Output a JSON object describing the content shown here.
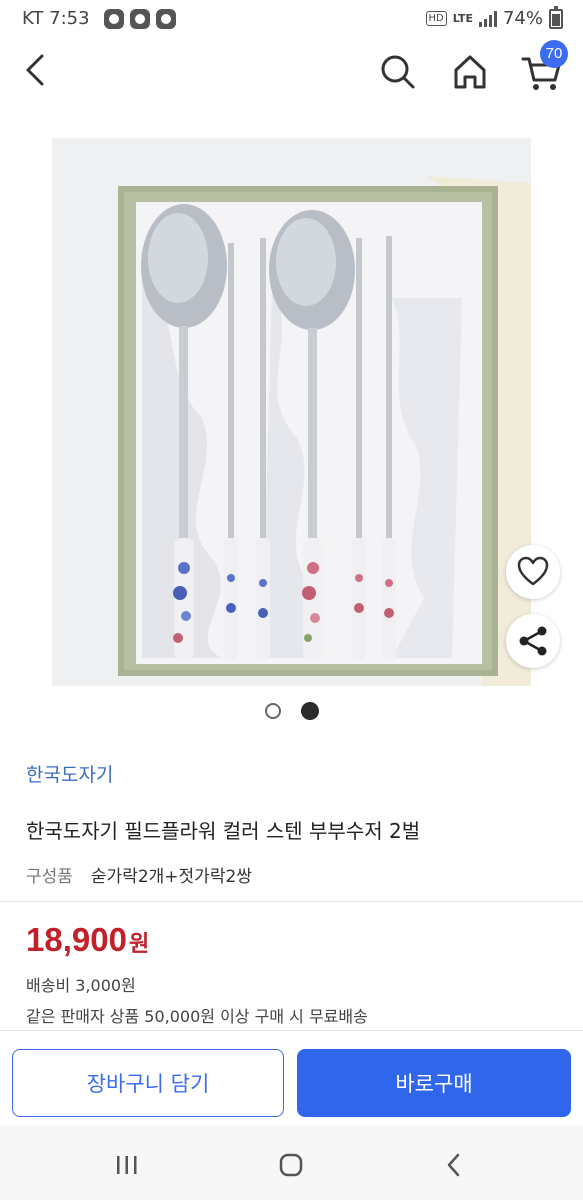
{
  "status_bar": {
    "carrier_time": "KT 7:53",
    "hd": "HD",
    "network": "LTE",
    "battery": "74%"
  },
  "header": {
    "cart_count": "70",
    "icons": [
      "back-icon",
      "search-icon",
      "home-icon",
      "cart-icon"
    ]
  },
  "gallery": {
    "image_count": 2,
    "active_index": 1
  },
  "product": {
    "brand": "한국도자기",
    "title": "한국도자기 필드플라워 컬러 스텐 부부수저 2벌",
    "composition_label": "구성품",
    "composition_value": "숟가락2개+젓가락2쌍",
    "price": "18,900",
    "price_unit": "원",
    "shipping": "배송비 3,000원",
    "free_shipping": "같은 판매자 상품 50,000원 이상 구매 시 무료배송"
  },
  "actions": {
    "add_to_cart": "장바구니 담기",
    "buy_now": "바로구매"
  },
  "colors": {
    "accent": "#2f66ec",
    "price": "#c0212b",
    "brand": "#3b6cc4"
  }
}
